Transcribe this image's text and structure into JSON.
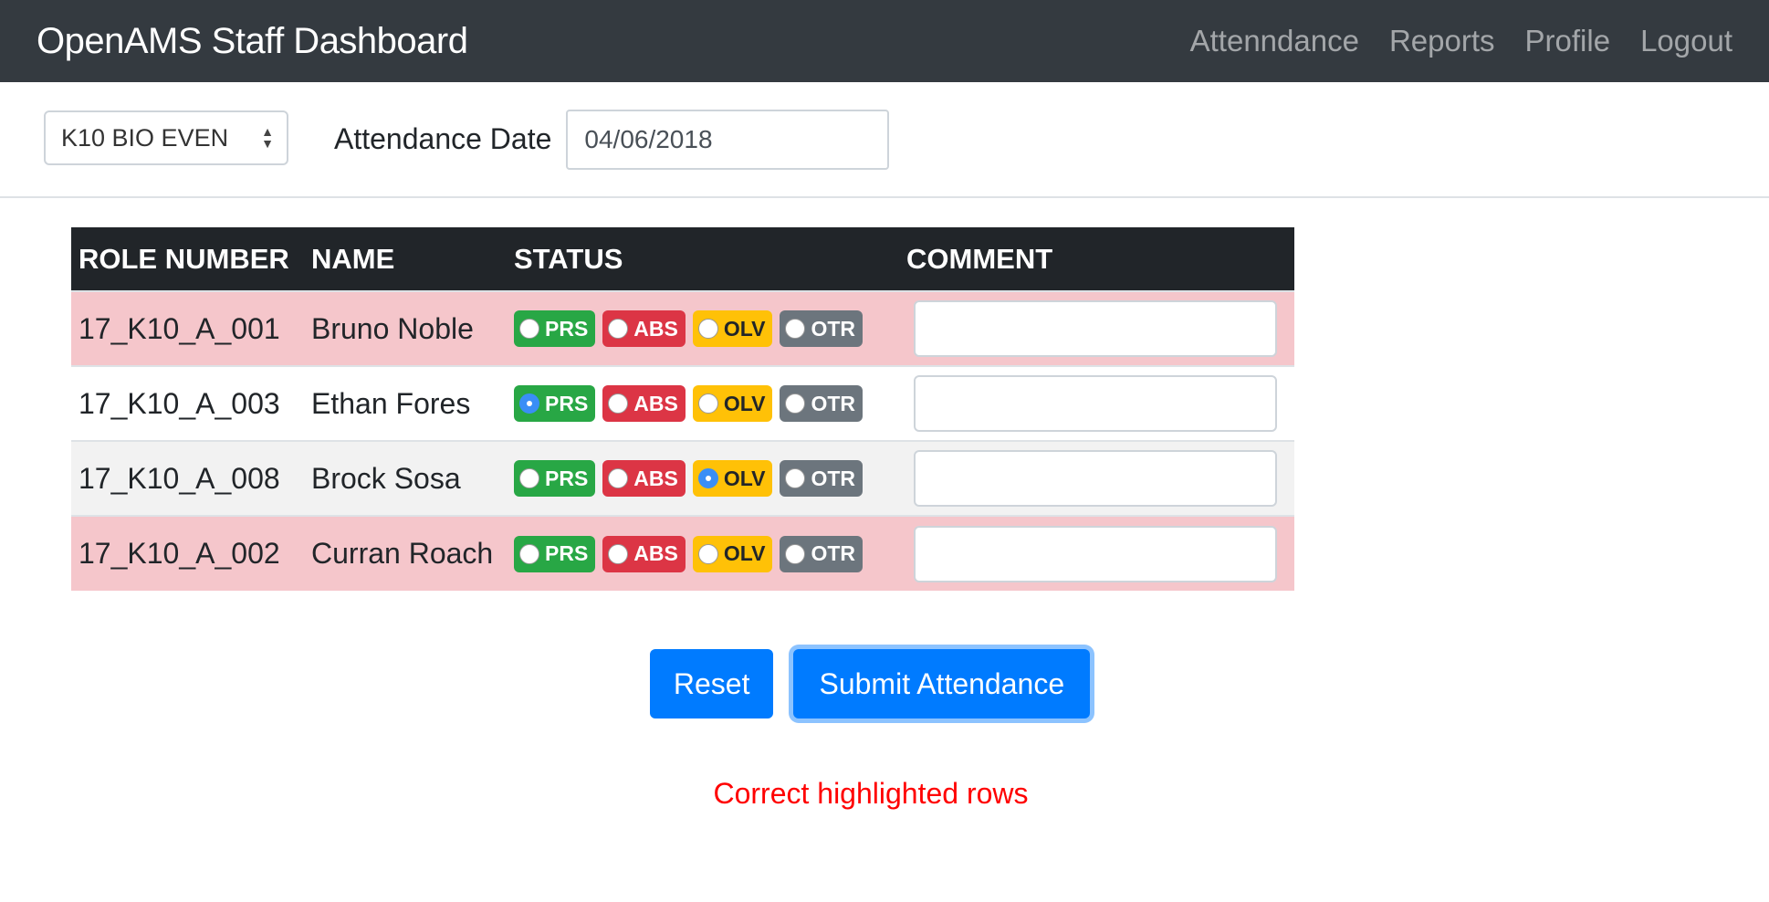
{
  "navbar": {
    "brand": "OpenAMS Staff Dashboard",
    "links": [
      "Attenndance",
      "Reports",
      "Profile",
      "Logout"
    ]
  },
  "controls": {
    "class_select_value": "K10 BIO EVEN",
    "date_label": "Attendance Date",
    "date_value": "04/06/2018"
  },
  "table": {
    "headers": [
      "ROLE NUMBER",
      "NAME",
      "STATUS",
      "COMMENT"
    ],
    "status_options": [
      "PRS",
      "ABS",
      "OLV",
      "OTR"
    ],
    "rows": [
      {
        "role": "17_K10_A_001",
        "name": "Bruno Noble",
        "selected": null,
        "comment": "",
        "highlight": "danger"
      },
      {
        "role": "17_K10_A_003",
        "name": "Ethan Fores",
        "selected": "PRS",
        "comment": "",
        "highlight": "none"
      },
      {
        "role": "17_K10_A_008",
        "name": "Brock Sosa",
        "selected": "OLV",
        "comment": "",
        "highlight": "light"
      },
      {
        "role": "17_K10_A_002",
        "name": "Curran Roach",
        "selected": null,
        "comment": "",
        "highlight": "danger"
      }
    ]
  },
  "actions": {
    "reset_label": "Reset",
    "submit_label": "Submit Attendance"
  },
  "message": "Correct highlighted rows",
  "colors": {
    "navbar_bg": "#343a40",
    "primary": "#007bff",
    "prs": "#28a745",
    "abs": "#dc3545",
    "olv": "#ffc107",
    "otr": "#6c757d",
    "danger_row": "#f5c6cb",
    "error_text": "#ff0000"
  }
}
